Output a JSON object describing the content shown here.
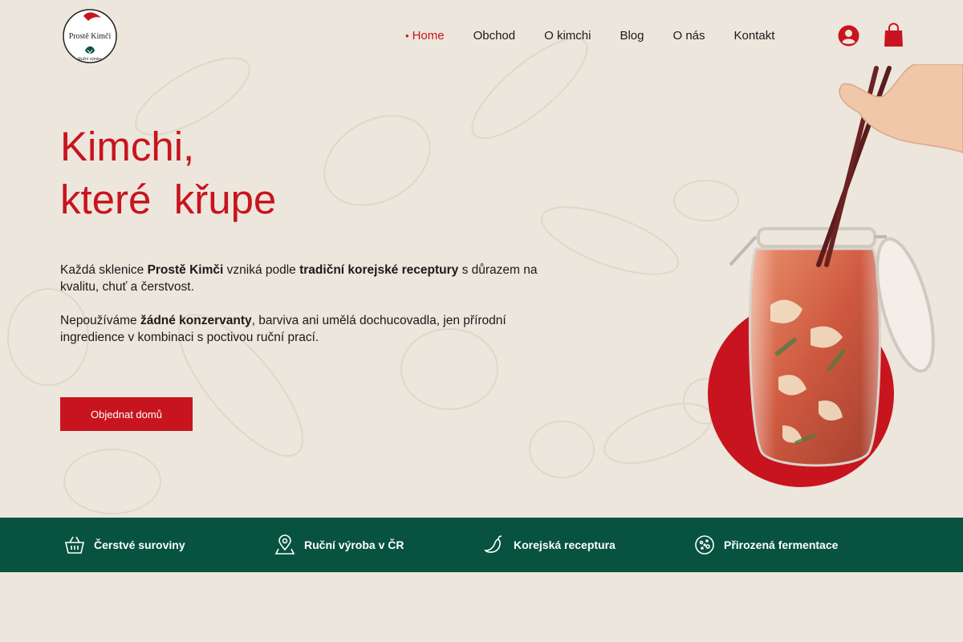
{
  "brand": {
    "logo_text": "Prostě Kimči",
    "logo_subtext": "Ruční výroba"
  },
  "nav": {
    "items": [
      {
        "label": "Home",
        "active": true
      },
      {
        "label": "Obchod",
        "active": false
      },
      {
        "label": "O kimchi",
        "active": false
      },
      {
        "label": "Blog",
        "active": false
      },
      {
        "label": "O nás",
        "active": false
      },
      {
        "label": "Kontakt",
        "active": false
      }
    ],
    "user_icon": "user-icon",
    "cart_icon": "shopping-bag-icon"
  },
  "hero": {
    "title_line1": "Kimchi,",
    "title_line2": "které  křupe",
    "p1": {
      "t1": "Každá sklenice ",
      "b1": "Prostě Kimči",
      "t2": " vzniká podle ",
      "b2": "tradiční korejské receptury",
      "t3": " s důrazem na kvalitu, chuť a čerstvost."
    },
    "p2": {
      "t1": "Nepoužíváme ",
      "b1": "žádné konzervanty",
      "t2": ", barviva ani umělá dochucovadla, jen přírodní ingredience v kombinaci s poctivou ruční prací."
    },
    "cta_label": "Objednat domů"
  },
  "features": [
    {
      "icon": "basket-icon",
      "label": "Čerstvé suroviny"
    },
    {
      "icon": "map-pin-icon",
      "label": "Ruční výroba v ČR"
    },
    {
      "icon": "chili-pepper-icon",
      "label": "Korejská receptura"
    },
    {
      "icon": "fermentation-icon",
      "label": "Přirozená fermentace"
    }
  ],
  "colors": {
    "accent": "#c8141e",
    "strip": "#07533f",
    "background": "#ede6dc"
  }
}
